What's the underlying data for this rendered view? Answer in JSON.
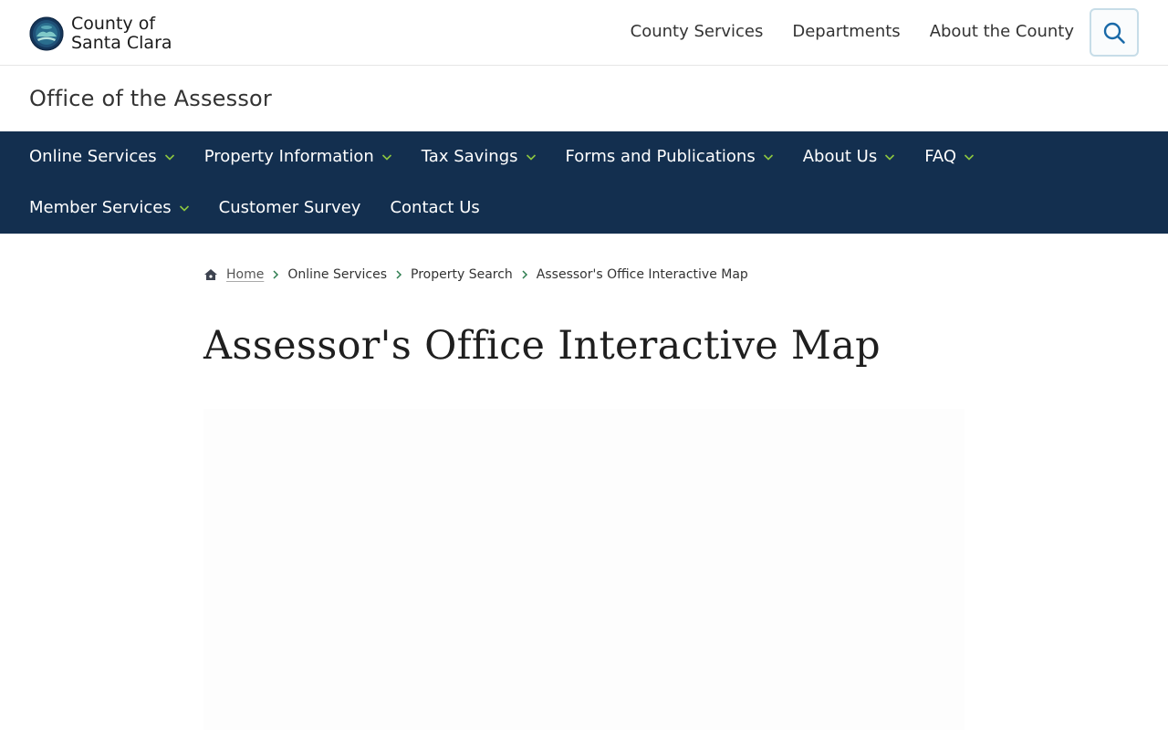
{
  "header": {
    "logo_line1": "County of",
    "logo_line2": "Santa Clara",
    "nav": [
      "County Services",
      "Departments",
      "About the County"
    ]
  },
  "office_title": "Office of the Assessor",
  "main_nav": {
    "row1": [
      {
        "label": "Online Services",
        "has_dropdown": true
      },
      {
        "label": "Property Information",
        "has_dropdown": true
      },
      {
        "label": "Tax Savings",
        "has_dropdown": true
      },
      {
        "label": "Forms and Publications",
        "has_dropdown": true
      },
      {
        "label": "About Us",
        "has_dropdown": true
      },
      {
        "label": "FAQ",
        "has_dropdown": true
      }
    ],
    "row2": [
      {
        "label": "Member Services",
        "has_dropdown": true
      },
      {
        "label": "Customer Survey",
        "has_dropdown": false
      },
      {
        "label": "Contact Us",
        "has_dropdown": false
      }
    ]
  },
  "breadcrumb": [
    "Home",
    "Online Services",
    "Property Search",
    "Assessor's Office Interactive Map"
  ],
  "page_title": "Assessor's Office Interactive Map",
  "colors": {
    "nav_bg": "#132f4f",
    "chevron": "#8cc63f",
    "search_icon": "#1a6aa8"
  }
}
